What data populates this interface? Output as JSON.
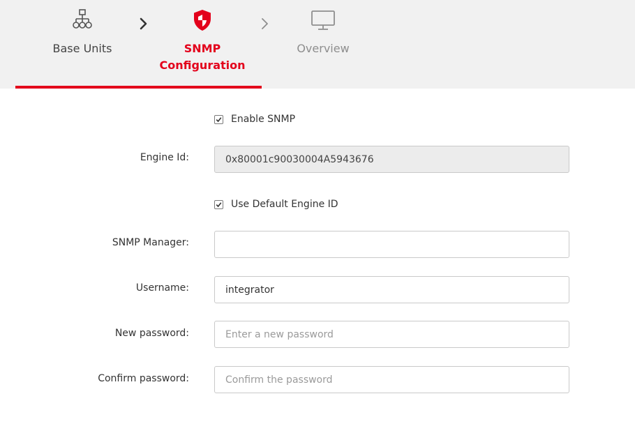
{
  "stepper": {
    "steps": [
      {
        "label": "Base Units",
        "icon": "network-icon",
        "state": "completed"
      },
      {
        "label": "SNMP Configuration",
        "label_line1": "SNMP",
        "label_line2": "Configuration",
        "icon": "shield-icon",
        "state": "active"
      },
      {
        "label": "Overview",
        "icon": "monitor-icon",
        "state": "upcoming"
      }
    ],
    "accent_color": "#e3001b"
  },
  "form": {
    "enable_snmp": {
      "label": "Enable SNMP",
      "checked": true
    },
    "engine_id": {
      "label": "Engine Id:",
      "value": "0x80001c90030004A5943676",
      "readonly": true
    },
    "use_default_engine_id": {
      "label": "Use Default Engine ID",
      "checked": true
    },
    "snmp_manager": {
      "label": "SNMP Manager:",
      "value": ""
    },
    "username": {
      "label": "Username:",
      "value": "integrator"
    },
    "new_password": {
      "label": "New password:",
      "value": "",
      "placeholder": "Enter a new password"
    },
    "confirm_password": {
      "label": "Confirm password:",
      "value": "",
      "placeholder": "Confirm the password"
    }
  }
}
